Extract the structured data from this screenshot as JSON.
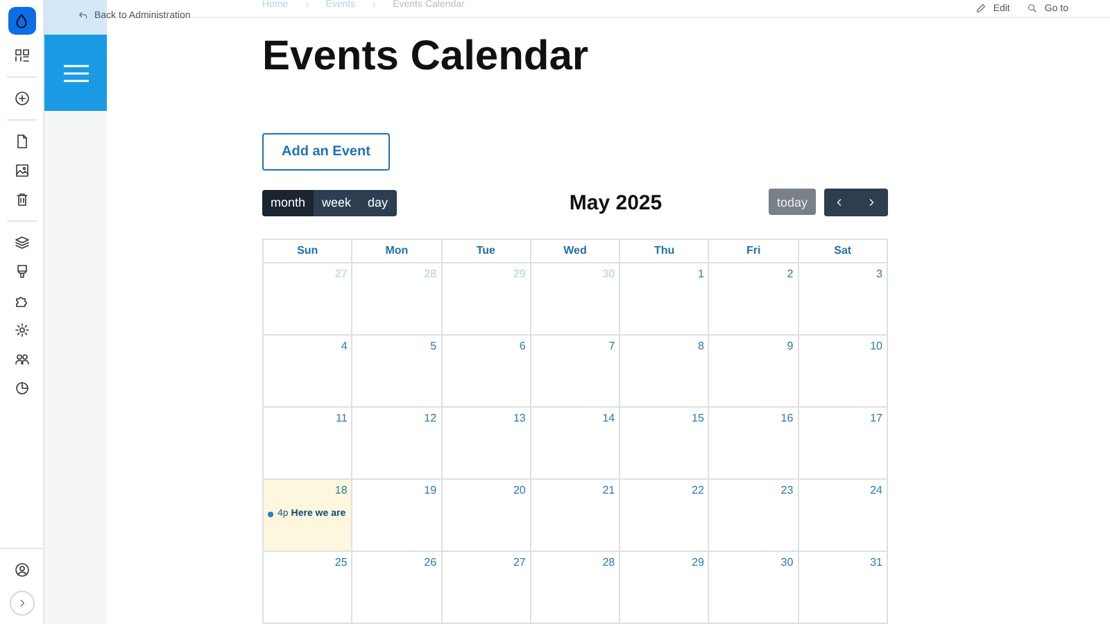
{
  "toolbar": {
    "back_link": "Back to Administration",
    "breadcrumb": [
      "Home",
      "Events",
      "Events Calendar"
    ],
    "actions": [
      {
        "kind": "edit",
        "label": "Edit"
      },
      {
        "kind": "search",
        "label": "Go to"
      }
    ]
  },
  "page": {
    "title": "Events Calendar",
    "add_button": "Add an Event"
  },
  "calendar": {
    "views": [
      {
        "label": "month",
        "selected": true
      },
      {
        "label": "week",
        "selected": false
      },
      {
        "label": "day",
        "selected": false
      }
    ],
    "title": "May 2025",
    "today_button": {
      "label": "today",
      "disabled": true
    },
    "weekdays": [
      "Sun",
      "Mon",
      "Tue",
      "Wed",
      "Thu",
      "Fri",
      "Sat"
    ],
    "weeks": [
      [
        {
          "day": "27",
          "other_month": true
        },
        {
          "day": "28",
          "other_month": true
        },
        {
          "day": "29",
          "other_month": true
        },
        {
          "day": "30",
          "other_month": true
        },
        {
          "day": "1",
          "other_month": false
        },
        {
          "day": "2",
          "other_month": false
        },
        {
          "day": "3",
          "other_month": false
        }
      ],
      [
        {
          "day": "4",
          "other_month": false
        },
        {
          "day": "5",
          "other_month": false
        },
        {
          "day": "6",
          "other_month": false
        },
        {
          "day": "7",
          "other_month": false
        },
        {
          "day": "8",
          "other_month": false
        },
        {
          "day": "9",
          "other_month": false
        },
        {
          "day": "10",
          "other_month": false
        }
      ],
      [
        {
          "day": "11",
          "other_month": false
        },
        {
          "day": "12",
          "other_month": false
        },
        {
          "day": "13",
          "other_month": false
        },
        {
          "day": "14",
          "other_month": false
        },
        {
          "day": "15",
          "other_month": false
        },
        {
          "day": "16",
          "other_month": false
        },
        {
          "day": "17",
          "other_month": false
        }
      ],
      [
        {
          "day": "18",
          "other_month": false,
          "today": true,
          "events": [
            {
              "time": "4p",
              "title": "Here we are"
            }
          ]
        },
        {
          "day": "19",
          "other_month": false
        },
        {
          "day": "20",
          "other_month": false
        },
        {
          "day": "21",
          "other_month": false
        },
        {
          "day": "22",
          "other_month": false
        },
        {
          "day": "23",
          "other_month": false
        },
        {
          "day": "24",
          "other_month": false
        }
      ],
      [
        {
          "day": "25",
          "other_month": false
        },
        {
          "day": "26",
          "other_month": false
        },
        {
          "day": "27",
          "other_month": false
        },
        {
          "day": "28",
          "other_month": false
        },
        {
          "day": "29",
          "other_month": false
        },
        {
          "day": "30",
          "other_month": false
        },
        {
          "day": "31",
          "other_month": false
        }
      ]
    ]
  }
}
